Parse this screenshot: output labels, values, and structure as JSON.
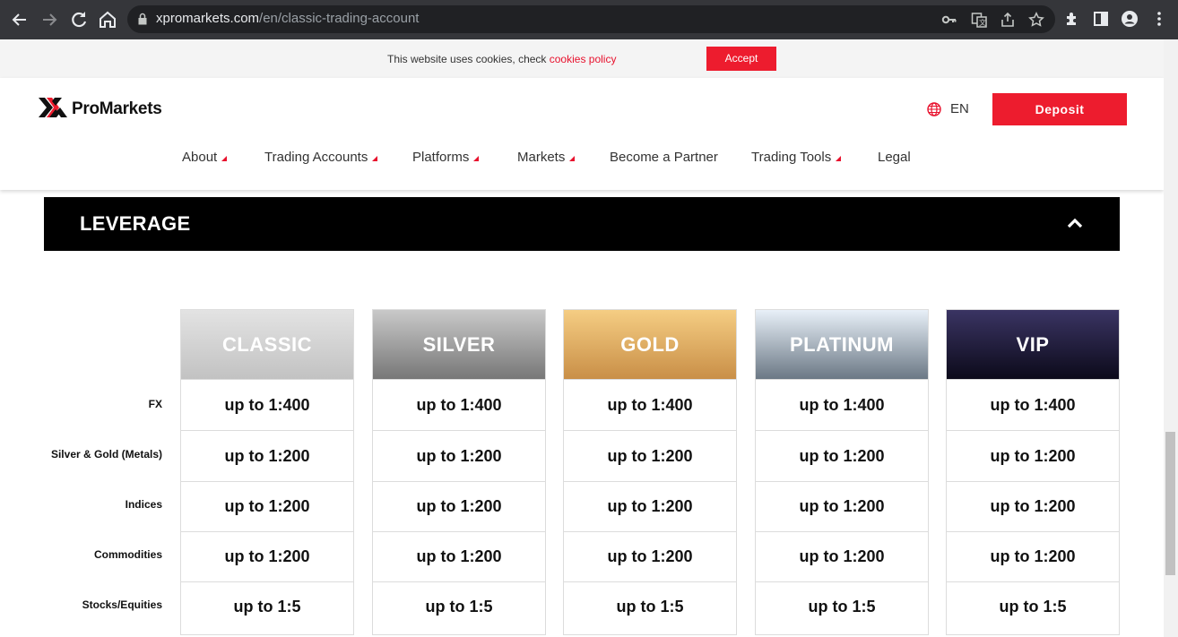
{
  "browser": {
    "url_host": "xpromarkets.com",
    "url_path": "/en/classic-trading-account"
  },
  "cookie_bar": {
    "text": "This website uses cookies, check ",
    "link": "cookies policy",
    "accept_label": "Accept"
  },
  "header": {
    "logo_text": "ProMarkets",
    "language": "EN",
    "deposit_label": "Deposit"
  },
  "nav": [
    {
      "label": "About",
      "dropdown": true
    },
    {
      "label": "Trading Accounts",
      "dropdown": true
    },
    {
      "label": "Platforms",
      "dropdown": true
    },
    {
      "label": "Markets",
      "dropdown": true
    },
    {
      "label": "Become a Partner",
      "dropdown": false
    },
    {
      "label": "Trading Tools",
      "dropdown": true
    },
    {
      "label": "Legal",
      "dropdown": false
    }
  ],
  "leverage": {
    "title": "LEVERAGE",
    "rows": [
      "FX",
      "Silver & Gold (Metals)",
      "Indices",
      "Commodities",
      "Stocks/Equities"
    ],
    "accounts": [
      {
        "name": "CLASSIC",
        "values": [
          "up to 1:400",
          "up to 1:200",
          "up to 1:200",
          "up to 1:200",
          "up to 1:5"
        ]
      },
      {
        "name": "SILVER",
        "values": [
          "up to 1:400",
          "up to 1:200",
          "up to 1:200",
          "up to 1:200",
          "up to 1:5"
        ]
      },
      {
        "name": "GOLD",
        "values": [
          "up to 1:400",
          "up to 1:200",
          "up to 1:200",
          "up to 1:200",
          "up to 1:5"
        ]
      },
      {
        "name": "PLATINUM",
        "values": [
          "up to 1:400",
          "up to 1:200",
          "up to 1:200",
          "up to 1:200",
          "up to 1:5"
        ]
      },
      {
        "name": "VIP",
        "values": [
          "up to 1:400",
          "up to 1:200",
          "up to 1:200",
          "up to 1:200",
          "up to 1:5"
        ]
      }
    ]
  },
  "colors": {
    "accent_red": "#ed1c2e",
    "header_black": "#000000"
  },
  "icons": {
    "back": "arrow-left-icon",
    "forward": "arrow-right-icon",
    "reload": "reload-icon",
    "home": "home-icon",
    "lock": "lock-icon",
    "key": "key-icon",
    "translate": "translate-icon",
    "share": "share-icon",
    "bookmark": "star-icon",
    "extensions": "puzzle-icon",
    "sidepanel": "side-panel-icon",
    "profile": "profile-icon",
    "menu": "kebab-menu-icon",
    "globe": "globe-icon",
    "collapse": "chevron-up-icon"
  }
}
